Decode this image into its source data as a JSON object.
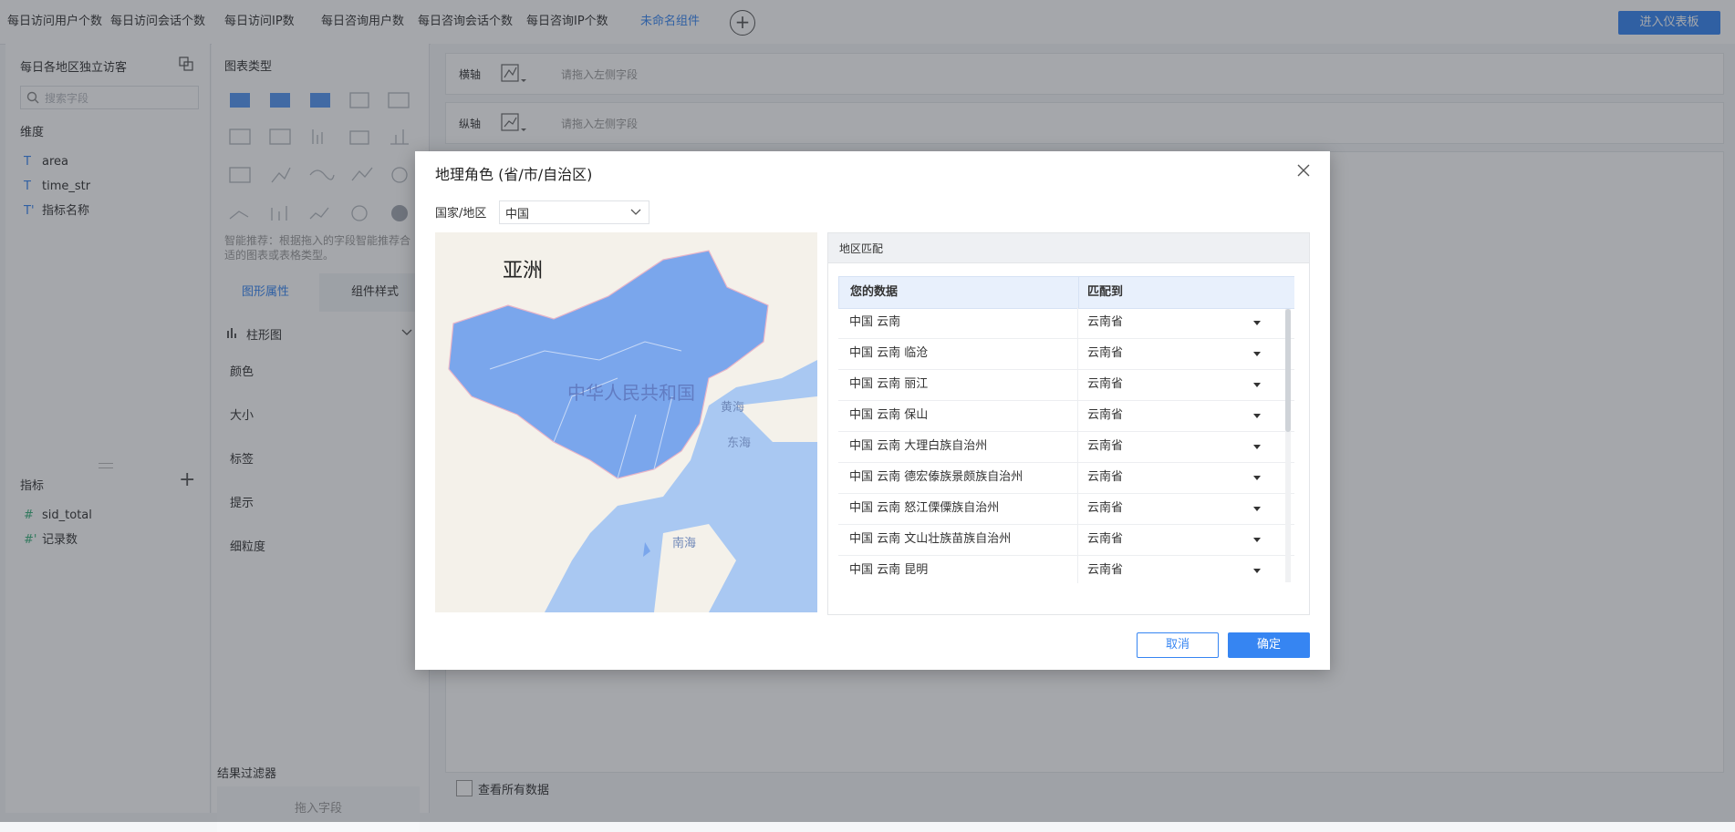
{
  "tabs": [
    {
      "label": "每日访问用户个数",
      "active": false
    },
    {
      "label": "每日访问会话个数",
      "active": false
    },
    {
      "label": "每日访问IP数",
      "active": false
    },
    {
      "label": "每日咨询用户数",
      "active": false
    },
    {
      "label": "每日咨询会话个数",
      "active": false
    },
    {
      "label": "每日咨询IP个数",
      "active": false
    },
    {
      "label": "未命名组件",
      "active": true
    }
  ],
  "enter_dashboard": "进入仪表板",
  "left": {
    "dataset_title": "每日各地区独立访客",
    "search_placeholder": "搜索字段",
    "dimension_title": "维度",
    "dimensions": [
      {
        "type": "T",
        "name": "area"
      },
      {
        "type": "T",
        "name": "time_str"
      },
      {
        "type": "T'",
        "name": "指标名称"
      }
    ],
    "metric_title": "指标",
    "metrics": [
      {
        "type": "#",
        "name": "sid_total"
      },
      {
        "type": "#'",
        "name": "记录数"
      }
    ]
  },
  "chart": {
    "type_title": "图表类型",
    "hint": "智能推荐：根据拖入的字段智能推荐合适的图表或表格类型。",
    "tab_shape": "图形属性",
    "tab_style": "组件样式",
    "selected_type": "柱形图",
    "props": [
      "颜色",
      "大小",
      "标签",
      "提示",
      "细粒度"
    ],
    "filter_title": "结果过滤器",
    "drop_hint": "拖入字段"
  },
  "main": {
    "x_axis_label": "横轴",
    "y_axis_label": "纵轴",
    "drop_placeholder": "请拖入左侧字段",
    "view_all": "查看所有数据"
  },
  "modal": {
    "title": "地理角色 (省/市/自治区)",
    "country_label": "国家/地区",
    "country_value": "中国",
    "map_labels": {
      "asia": "亚洲",
      "china": "中华人民共和国",
      "yellow_sea": "黄海",
      "east_sea": "东海",
      "south_sea": "南海"
    },
    "match_title": "地区匹配",
    "col_data": "您的数据",
    "col_match": "匹配到",
    "rows": [
      {
        "data": "中国 云南",
        "match": "云南省"
      },
      {
        "data": "中国 云南 临沧",
        "match": "云南省"
      },
      {
        "data": "中国 云南 丽江",
        "match": "云南省"
      },
      {
        "data": "中国 云南 保山",
        "match": "云南省"
      },
      {
        "data": "中国 云南 大理白族自治州",
        "match": "云南省"
      },
      {
        "data": "中国 云南 德宏傣族景颇族自治州",
        "match": "云南省"
      },
      {
        "data": "中国 云南 怒江傈僳族自治州",
        "match": "云南省"
      },
      {
        "data": "中国 云南 文山壮族苗族自治州",
        "match": "云南省"
      },
      {
        "data": "中国 云南 昆明",
        "match": "云南省"
      }
    ],
    "cancel": "取消",
    "confirm": "确定"
  },
  "colors": {
    "accent": "#3685f2",
    "land": "#7aa6ec",
    "sea": "#a9c8f2",
    "landmass": "#f4f1ea"
  }
}
